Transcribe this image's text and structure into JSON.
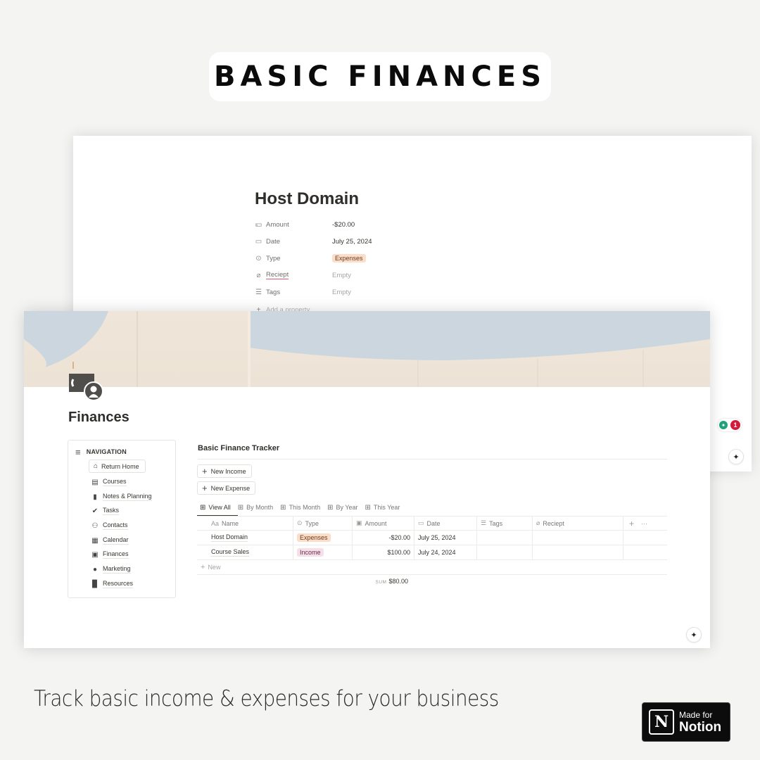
{
  "hero": {
    "title": "BASIC FINANCES"
  },
  "detail_page": {
    "title": "Host Domain",
    "properties": [
      {
        "icon": "money-icon",
        "label": "Amount",
        "value": "-$20.00",
        "kind": "text"
      },
      {
        "icon": "calendar-icon",
        "label": "Date",
        "value": "July 25, 2024",
        "kind": "text"
      },
      {
        "icon": "select-icon",
        "label": "Type",
        "value": "Expenses",
        "kind": "tag"
      },
      {
        "icon": "paperclip-icon",
        "label": "Reciept",
        "value": "Empty",
        "kind": "empty"
      },
      {
        "icon": "list-icon",
        "label": "Tags",
        "value": "Empty",
        "kind": "empty"
      }
    ],
    "add_property": "Add a property"
  },
  "side_badges": {
    "notification_count": "1"
  },
  "page": {
    "title": "Finances",
    "icon": "money-icon"
  },
  "navigation": {
    "heading": "NAVIGATION",
    "return_home": "Return Home",
    "items": [
      {
        "icon": "archive-icon",
        "label": "Courses"
      },
      {
        "icon": "document-icon",
        "label": "Notes & Planning"
      },
      {
        "icon": "check-circle-icon",
        "label": "Tasks"
      },
      {
        "icon": "people-icon",
        "label": "Contacts"
      },
      {
        "icon": "calendar-icon",
        "label": "Calendar"
      },
      {
        "icon": "money-icon",
        "label": "Finances"
      },
      {
        "icon": "chat-bubbles-icon",
        "label": "Marketing"
      },
      {
        "icon": "book-icon",
        "label": "Resources"
      }
    ]
  },
  "tracker": {
    "title": "Basic Finance Tracker",
    "buttons": {
      "new_income": "New Income",
      "new_expense": "New Expense"
    },
    "tabs": [
      "View All",
      "By Month",
      "This Month",
      "By Year",
      "This Year"
    ],
    "active_tab": "View All",
    "columns": [
      {
        "icon": "Aa",
        "label": "Name"
      },
      {
        "icon": "select-icon",
        "label": "Type"
      },
      {
        "icon": "money-icon",
        "label": "Amount"
      },
      {
        "icon": "calendar-icon",
        "label": "Date"
      },
      {
        "icon": "list-icon",
        "label": "Tags"
      },
      {
        "icon": "paperclip-icon",
        "label": "Reciept"
      }
    ],
    "rows": [
      {
        "name": "Host Domain",
        "type": "Expenses",
        "amount": "-$20.00",
        "date": "July 25, 2024",
        "tags": "",
        "reciept": ""
      },
      {
        "name": "Course Sales",
        "type": "Income",
        "amount": "$100.00",
        "date": "July 24, 2024",
        "tags": "",
        "reciept": ""
      }
    ],
    "new_row": "New",
    "sum_label": "SUM",
    "sum_value": "$80.00"
  },
  "tagline": "Track basic income & expenses for your business",
  "badge": {
    "small": "Made for",
    "big": "Notion",
    "logo": "N"
  },
  "colors": {
    "expenses_tag_bg": "#fadec9",
    "income_tag_bg": "#f5e0e9",
    "notification_red": "#d4193b",
    "bulb_green": "#1fa37d"
  }
}
